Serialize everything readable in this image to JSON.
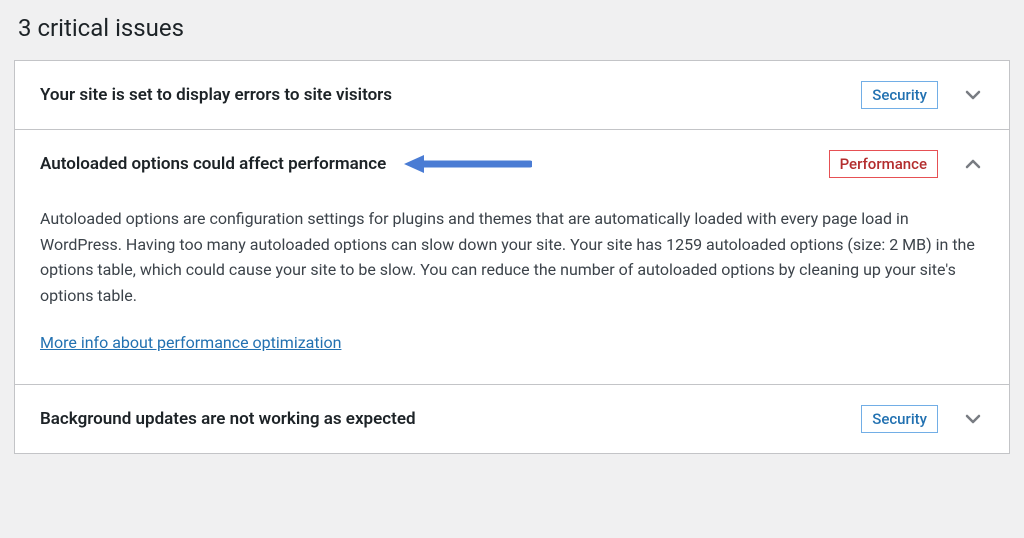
{
  "heading": "3 critical issues",
  "items": [
    {
      "title": "Your site is set to display errors to site visitors",
      "badge": "Security",
      "badgeType": "security",
      "expanded": false
    },
    {
      "title": "Autoloaded options could affect performance",
      "badge": "Performance",
      "badgeType": "performance",
      "expanded": true,
      "description": "Autoloaded options are configuration settings for plugins and themes that are automatically loaded with every page load in WordPress. Having too many autoloaded options can slow down your site. Your site has 1259 autoloaded options (size: 2 MB) in the options table, which could cause your site to be slow. You can reduce the number of autoloaded options by cleaning up your site's options table.",
      "linkText": "More info about performance optimization"
    },
    {
      "title": "Background updates are not working as expected",
      "badge": "Security",
      "badgeType": "security",
      "expanded": false
    }
  ]
}
